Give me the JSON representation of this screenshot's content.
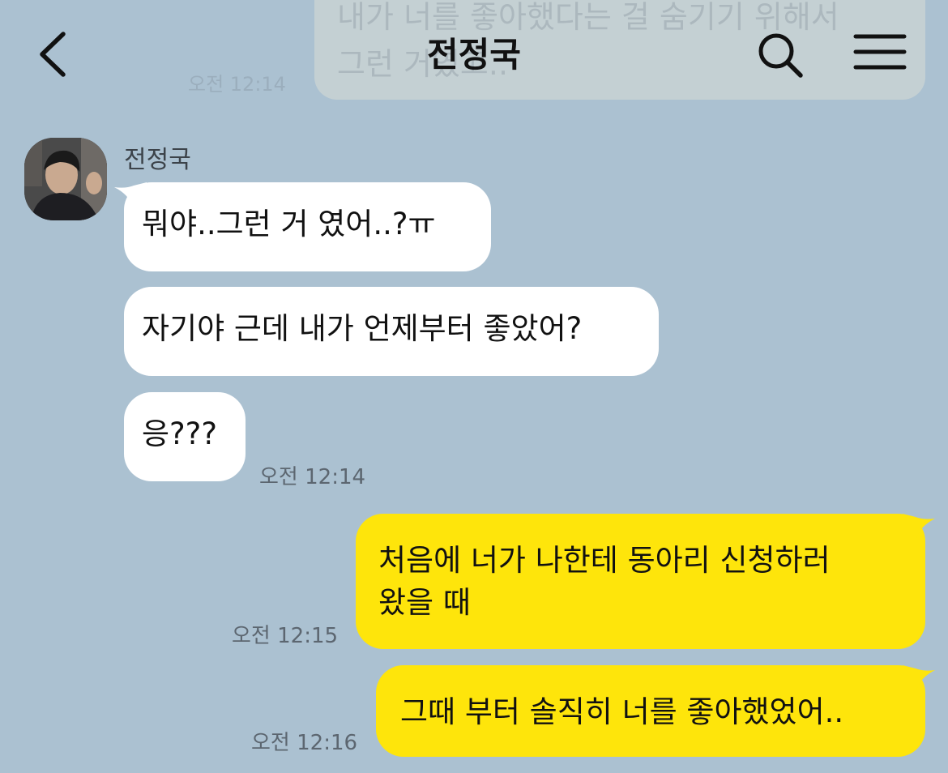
{
  "header": {
    "title": "전정국",
    "ghost_message": "내가 너를 좋아했다는 걸 숨기기 위해서\n그런 거였고..",
    "ghost_time": "오전 12:14",
    "back_icon": "chevron-left-icon",
    "search_icon": "search-icon",
    "menu_icon": "hamburger-menu-icon"
  },
  "friend": {
    "name": "전정국",
    "avatar_icon": "profile-photo"
  },
  "messages": [
    {
      "side": "in",
      "text": "뭐야..그런 거 였어..?ㅠ"
    },
    {
      "side": "in",
      "text": "자기야 근데 내가 언제부터 좋았어?"
    },
    {
      "side": "in",
      "text": "응???",
      "time": "오전 12:14"
    },
    {
      "side": "out",
      "line1": "처음에 너가 나한테 동아리 신청하러",
      "line2": "왔을 때",
      "time": "오전 12:15"
    },
    {
      "side": "out",
      "text": "그때 부터 솔직히 너를 좋아했었어..",
      "time": "오전 12:16"
    }
  ],
  "colors": {
    "background": "#abc1d1",
    "incoming_bubble": "#ffffff",
    "outgoing_bubble": "#fee50b",
    "timestamp": "#5c6670"
  }
}
